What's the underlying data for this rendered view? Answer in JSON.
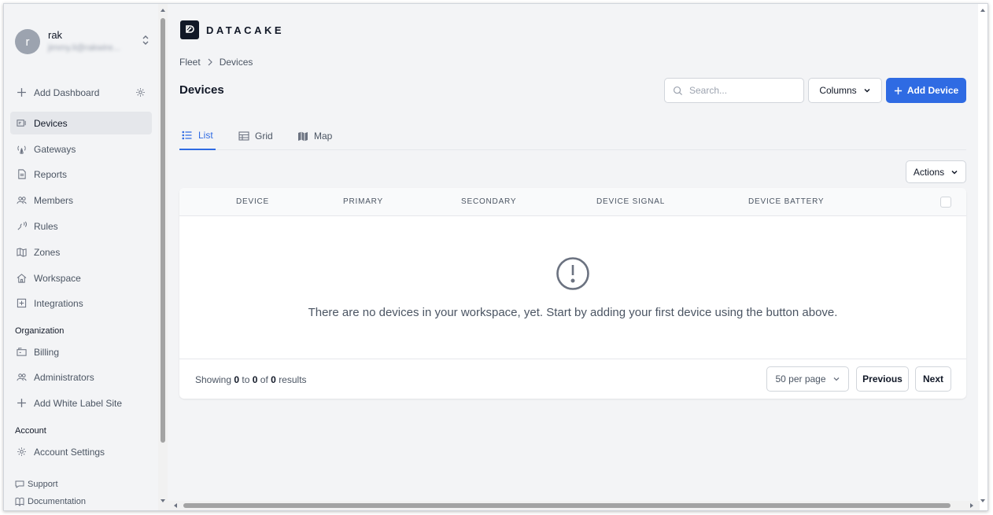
{
  "user": {
    "name": "rak",
    "initial": "r",
    "email": "jimmy.li@rakwire..."
  },
  "sidebar": {
    "add_dashboard": "Add Dashboard",
    "items": [
      {
        "label": "Devices",
        "icon": "devices-icon",
        "active": true
      },
      {
        "label": "Gateways",
        "icon": "gateway-icon"
      },
      {
        "label": "Reports",
        "icon": "document-icon"
      },
      {
        "label": "Members",
        "icon": "users-icon"
      },
      {
        "label": "Rules",
        "icon": "rules-icon"
      },
      {
        "label": "Zones",
        "icon": "map-icon"
      },
      {
        "label": "Workspace",
        "icon": "home-icon"
      },
      {
        "label": "Integrations",
        "icon": "plus-box-icon"
      }
    ],
    "organization_label": "Organization",
    "organization_items": [
      {
        "label": "Billing",
        "icon": "billing-icon"
      },
      {
        "label": "Administrators",
        "icon": "users-icon"
      },
      {
        "label": "Add White Label Site",
        "icon": "plus-icon"
      }
    ],
    "account_label": "Account",
    "account_items": [
      {
        "label": "Account Settings",
        "icon": "gear-icon"
      }
    ],
    "support": "Support",
    "documentation": "Documentation"
  },
  "brand": {
    "name": "DATACAKE"
  },
  "breadcrumb": {
    "root": "Fleet",
    "current": "Devices"
  },
  "page": {
    "title": "Devices"
  },
  "toolbar": {
    "search_placeholder": "Search...",
    "columns_label": "Columns",
    "add_device_label": "Add Device",
    "accent": "#2f6be3"
  },
  "tabs": [
    {
      "label": "List",
      "icon": "list-icon",
      "active": true
    },
    {
      "label": "Grid",
      "icon": "grid-icon"
    },
    {
      "label": "Map",
      "icon": "map-icon"
    }
  ],
  "actions_label": "Actions",
  "table": {
    "columns": [
      "DEVICE",
      "PRIMARY",
      "SECONDARY",
      "DEVICE SIGNAL",
      "DEVICE BATTERY"
    ],
    "empty_message": "There are no devices in your workspace, yet. Start by adding your first device using the button above."
  },
  "pagination": {
    "showing_prefix": "Showing",
    "from": "0",
    "to_word": "to",
    "to": "0",
    "of_word": "of",
    "total": "0",
    "results_word": "results",
    "per_page": "50 per page",
    "previous": "Previous",
    "next": "Next"
  }
}
